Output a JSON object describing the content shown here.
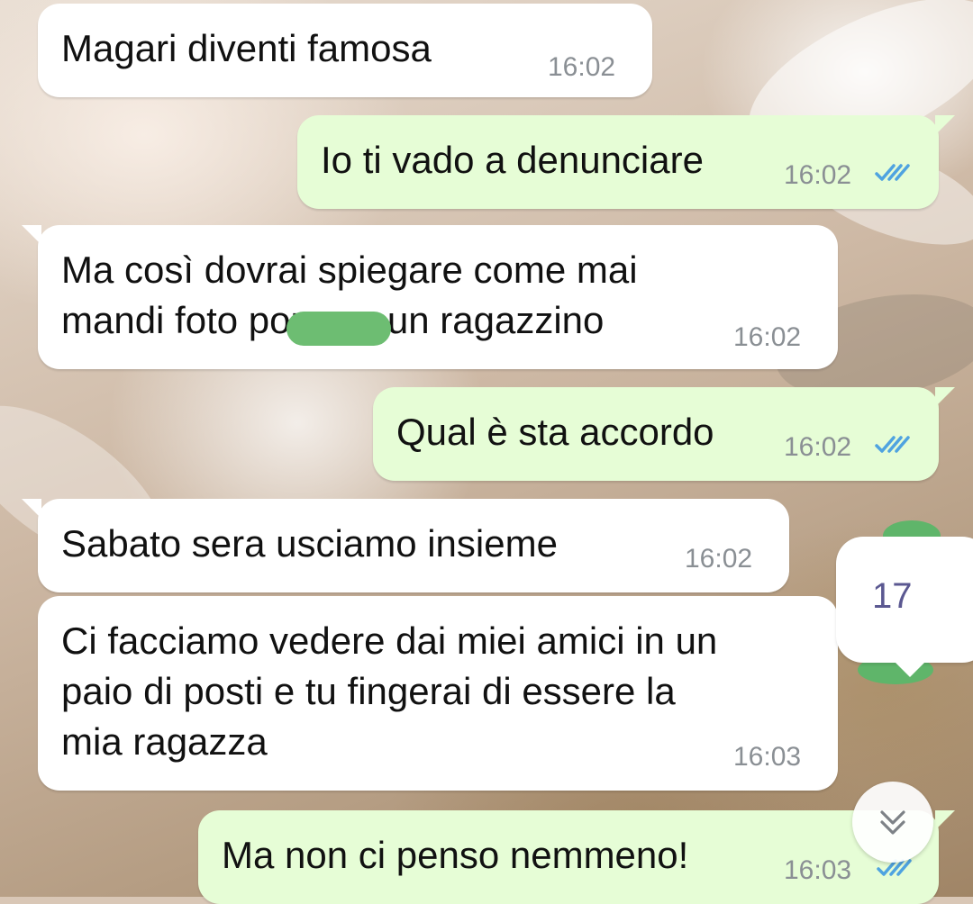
{
  "colors": {
    "incoming_bubble": "#ffffff",
    "outgoing_bubble": "#e6fdd6",
    "timestamp": "#8a8f94",
    "read_ticks": "#4fa3e0",
    "badge_text": "#5b5891",
    "redaction": "#6dbd72"
  },
  "messages": [
    {
      "direction": "incoming",
      "text": "Magari diventi famosa",
      "time": "16:02"
    },
    {
      "direction": "outgoing",
      "text": "Io ti vado a denunciare",
      "time": "16:02",
      "status_icon": "double-check-read-icon"
    },
    {
      "direction": "incoming",
      "text": "Ma così dovrai spiegare come mai\nmandi foto porno a un ragazzino",
      "time": "16:02"
    },
    {
      "direction": "outgoing",
      "text": "Qual è sta accordo",
      "time": "16:02",
      "status_icon": "double-check-read-icon"
    },
    {
      "direction": "incoming",
      "text": "Sabato sera usciamo insieme",
      "time": "16:02"
    },
    {
      "direction": "incoming",
      "text": "Ci facciamo vedere dai miei amici in un\npaio di posti e tu fingerai di essere la\nmia ragazza",
      "time": "16:03"
    },
    {
      "direction": "outgoing",
      "text": "Ma non ci penso nemmeno!",
      "time": "16:03",
      "status_icon": "double-check-read-icon"
    }
  ],
  "unread_badge": {
    "count": "17"
  },
  "scroll_button": {
    "icon": "double-chevron-down-icon"
  }
}
